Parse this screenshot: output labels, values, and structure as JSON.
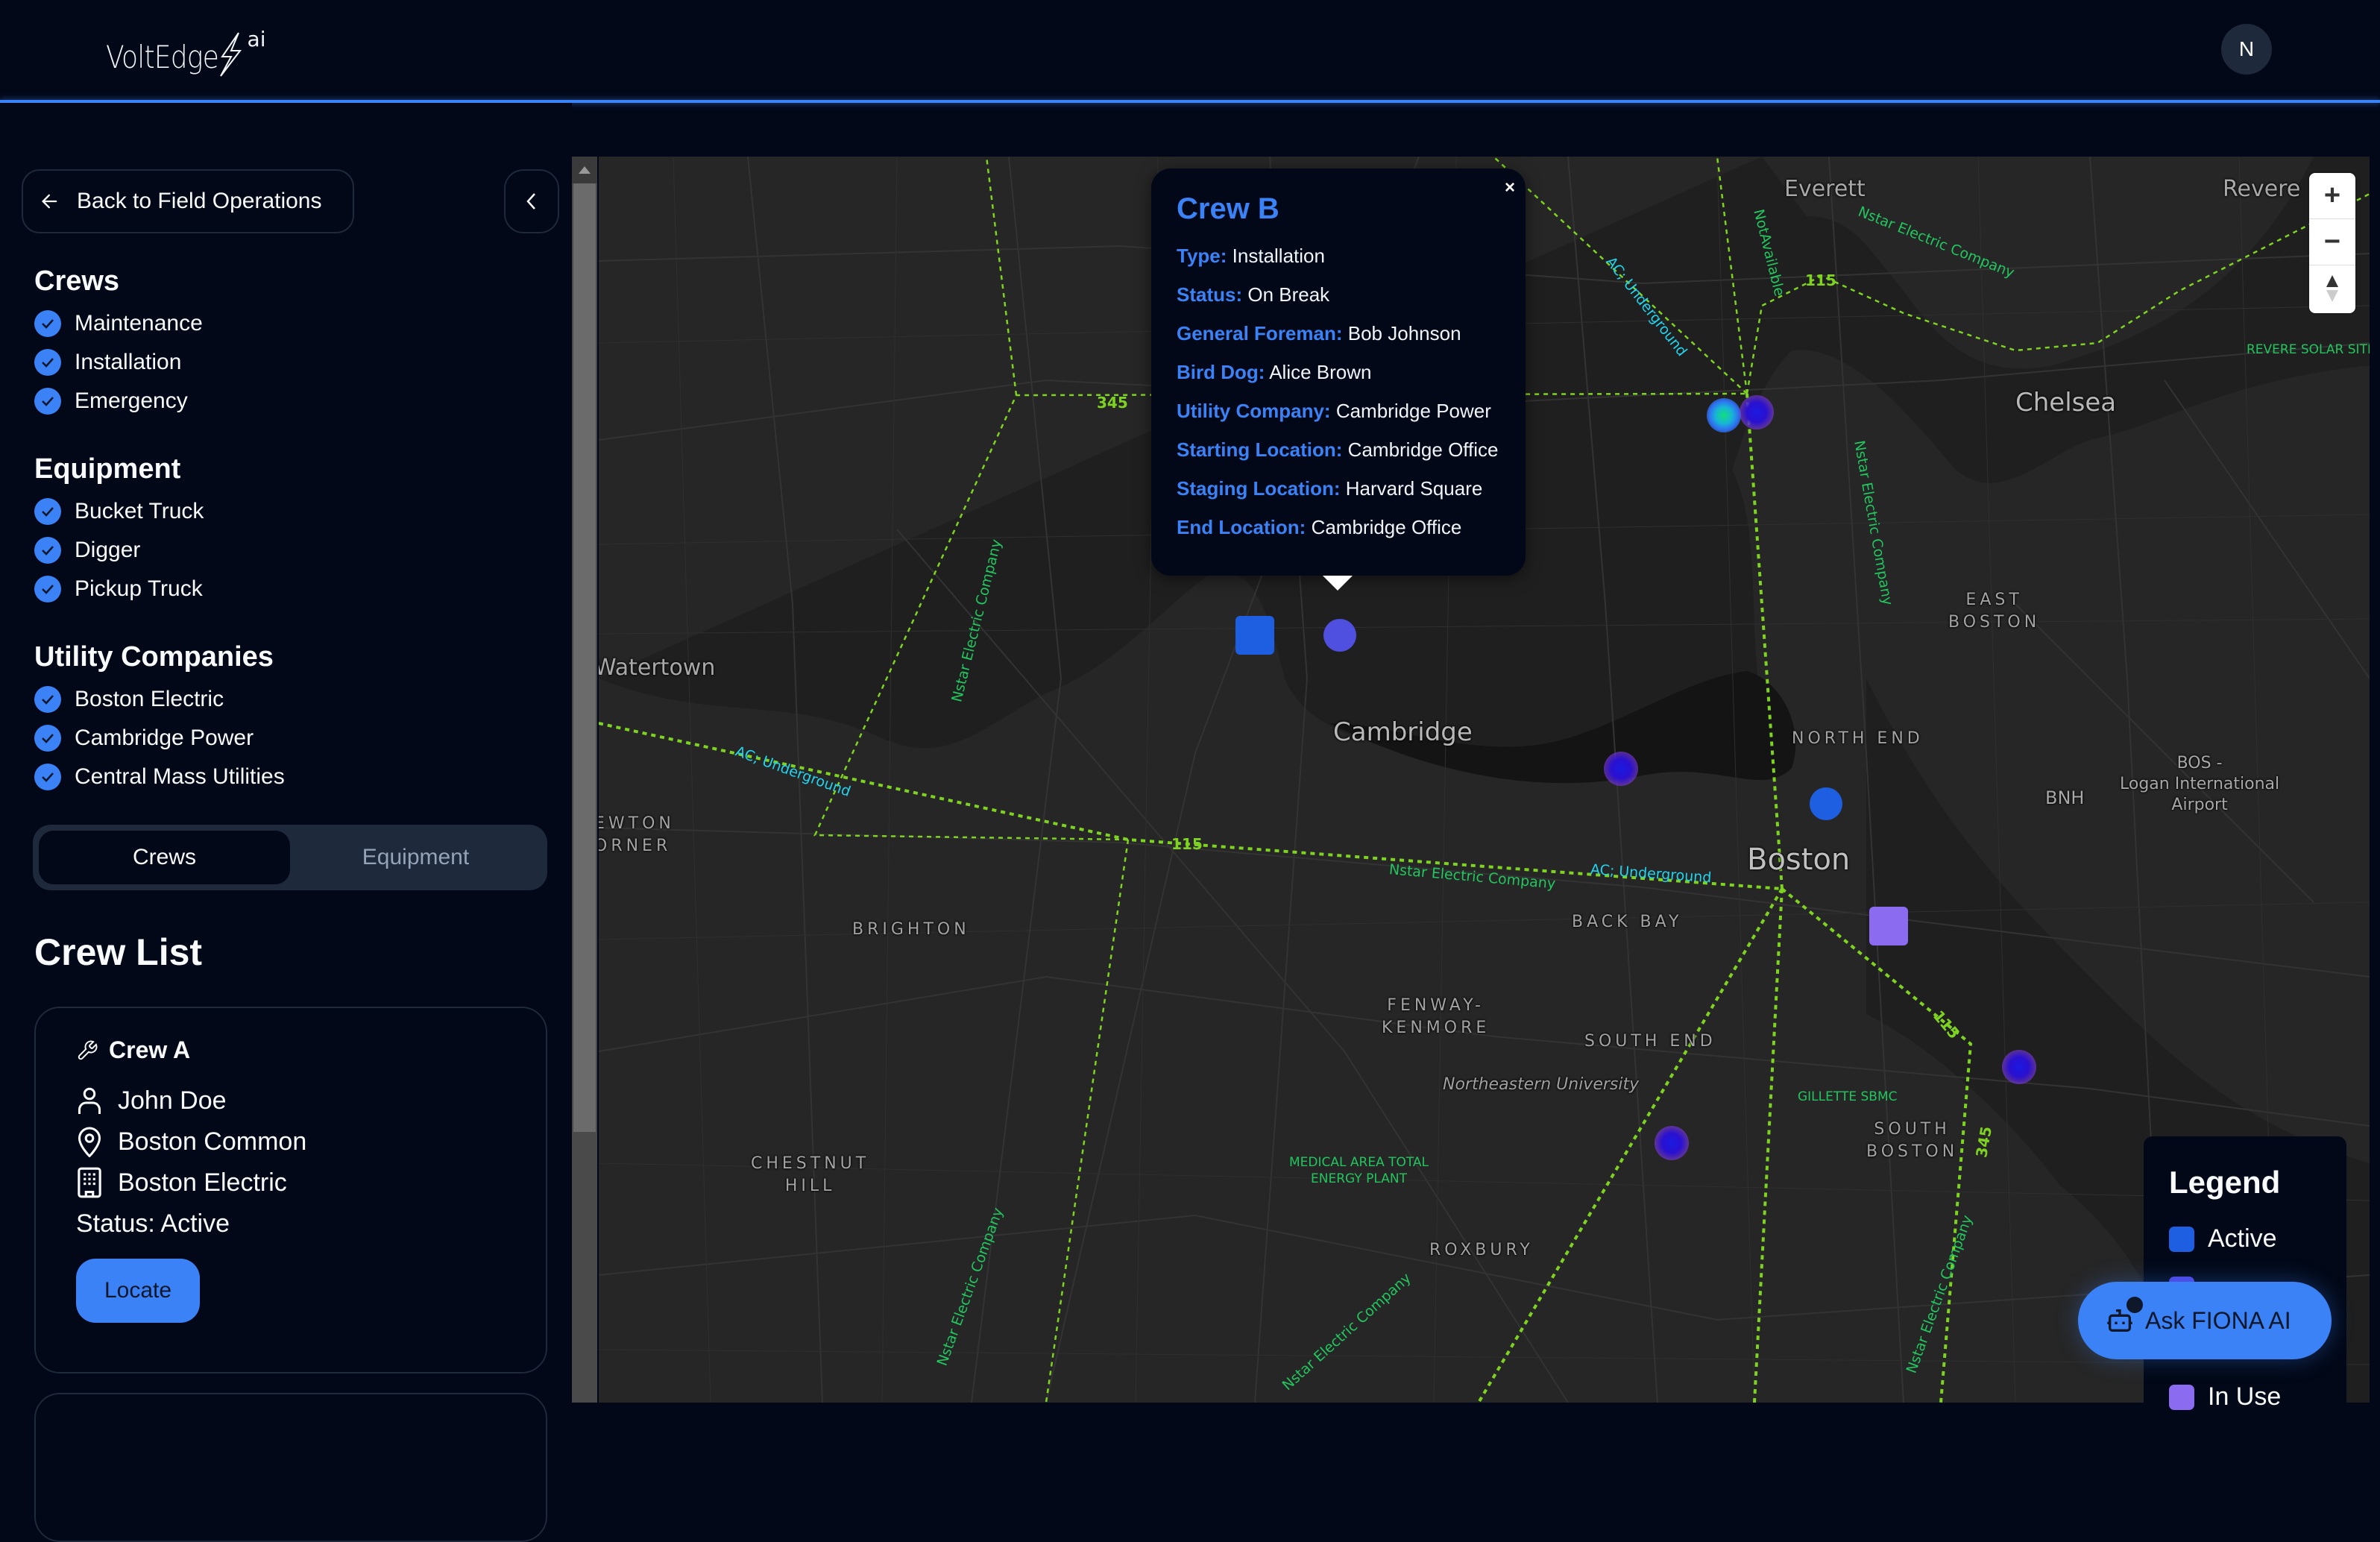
{
  "header": {
    "logo_text": "VoltEdge",
    "logo_suffix": "ai",
    "avatar_initial": "N"
  },
  "sidebar": {
    "back_label": "Back to Field Operations",
    "filters": [
      {
        "title": "Crews",
        "items": [
          {
            "label": "Maintenance",
            "checked": true
          },
          {
            "label": "Installation",
            "checked": true
          },
          {
            "label": "Emergency",
            "checked": true
          }
        ]
      },
      {
        "title": "Equipment",
        "items": [
          {
            "label": "Bucket Truck",
            "checked": true
          },
          {
            "label": "Digger",
            "checked": true
          },
          {
            "label": "Pickup Truck",
            "checked": true
          }
        ]
      },
      {
        "title": "Utility Companies",
        "items": [
          {
            "label": "Boston Electric",
            "checked": true
          },
          {
            "label": "Cambridge Power",
            "checked": true
          },
          {
            "label": "Central Mass Utilities",
            "checked": true
          }
        ]
      }
    ],
    "tabs": [
      {
        "label": "Crews",
        "active": true
      },
      {
        "label": "Equipment",
        "active": false
      }
    ],
    "list_title": "Crew List",
    "crews": [
      {
        "name": "Crew A",
        "icon": "wrench-icon",
        "foreman": "John Doe",
        "location": "Boston Common",
        "company": "Boston Electric",
        "status": "Status: Active",
        "locate_label": "Locate"
      }
    ]
  },
  "map": {
    "labels": {
      "everett": "Everett",
      "revere": "Revere",
      "chelsea": "Chelsea",
      "watertown": "Watertown",
      "cambridge": "Cambridge",
      "boston": "Boston",
      "east_boston": "EAST\nBOSTON",
      "north_end": "NORTH END",
      "newton_corner": "EWTON\nORNER",
      "brighton": "BRIGHTON",
      "back_bay": "BACK BAY",
      "fenway": "FENWAY-\nKENMORE",
      "south_end": "SOUTH END",
      "northeastern": "Northeastern University",
      "south_boston": "SOUTH\nBOSTON",
      "chestnut_hill": "CHESTNUT\nHILL",
      "roxbury": "ROXBURY",
      "bnh": "BNH",
      "logan": "BOS -\nLogan International\nAirport",
      "revere_solar": "REVERE SOLAR SITE",
      "gillette": "GILLETTE SBMC",
      "medical": "MEDICAL AREA TOTAL\nENERGY PLANT"
    },
    "line_labels": {
      "nstar": "Nstar Electric Company",
      "ac_underground": "AC; Underground",
      "not_available": "NotAvailable",
      "v345": "345",
      "v115": "115"
    },
    "zoom_in": "+",
    "zoom_out": "−"
  },
  "popup": {
    "title": "Crew B",
    "close": "×",
    "fields": [
      {
        "key": "Type:",
        "value": "Installation"
      },
      {
        "key": "Status:",
        "value": "On Break"
      },
      {
        "key": "General Foreman:",
        "value": "Bob Johnson"
      },
      {
        "key": "Bird Dog:",
        "value": "Alice Brown"
      },
      {
        "key": "Utility Company:",
        "value": "Cambridge Power"
      },
      {
        "key": "Starting Location:",
        "value": "Cambridge Office"
      },
      {
        "key": "Staging Location:",
        "value": "Harvard Square"
      },
      {
        "key": "End Location:",
        "value": "Cambridge Office"
      }
    ]
  },
  "legend": {
    "title": "Legend",
    "items": [
      {
        "label": "Active",
        "color": "#1d5fe0"
      },
      {
        "label": "",
        "color": "#4f46e5"
      },
      {
        "label": "In Use",
        "color": "#8b6cf0"
      }
    ]
  },
  "assistant": {
    "label": "Ask FIONA AI"
  },
  "colors": {
    "accent": "#3b82f6",
    "marker_active": "#1d5fe0",
    "marker_on_break": "#4f4fe0",
    "marker_in_use": "#8b6cf0",
    "powerline": "#7ed321"
  }
}
